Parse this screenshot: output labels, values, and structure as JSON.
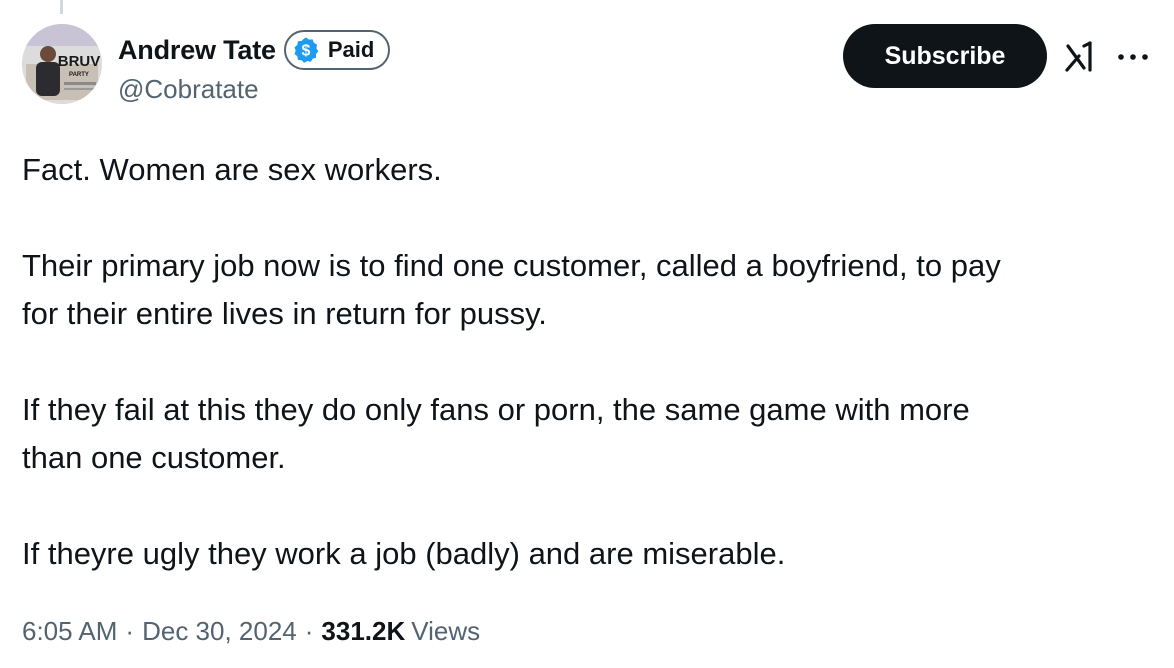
{
  "author": {
    "display_name": "Andrew Tate",
    "handle": "@Cobratate",
    "badge_label": "Paid",
    "badge_icon": "dollar-coin-icon",
    "badge_color": "#1d9bf0",
    "avatar_text": "BRUV",
    "avatar_subtext": "PARTY"
  },
  "actions": {
    "subscribe_label": "Subscribe",
    "grok_icon": "grok-icon",
    "more_icon": "more-dots-icon"
  },
  "tweet": {
    "paragraphs": [
      "Fact. Women are sex workers.",
      "Their primary job now is to find one customer, called a boyfriend, to pay\nfor their entire lives in return for pussy.",
      "If they fail at this they do only fans or porn, the same game with more\nthan one customer.",
      "If theyre ugly they work a job (badly) and are miserable."
    ]
  },
  "meta": {
    "time": "6:05 AM",
    "separator": "·",
    "date": "Dec 30, 2024",
    "views_count": "331.2K",
    "views_label": "Views"
  },
  "colors": {
    "text_primary": "#0f1419",
    "text_secondary": "#536471",
    "button_bg": "#0f1419",
    "accent": "#1d9bf0"
  }
}
